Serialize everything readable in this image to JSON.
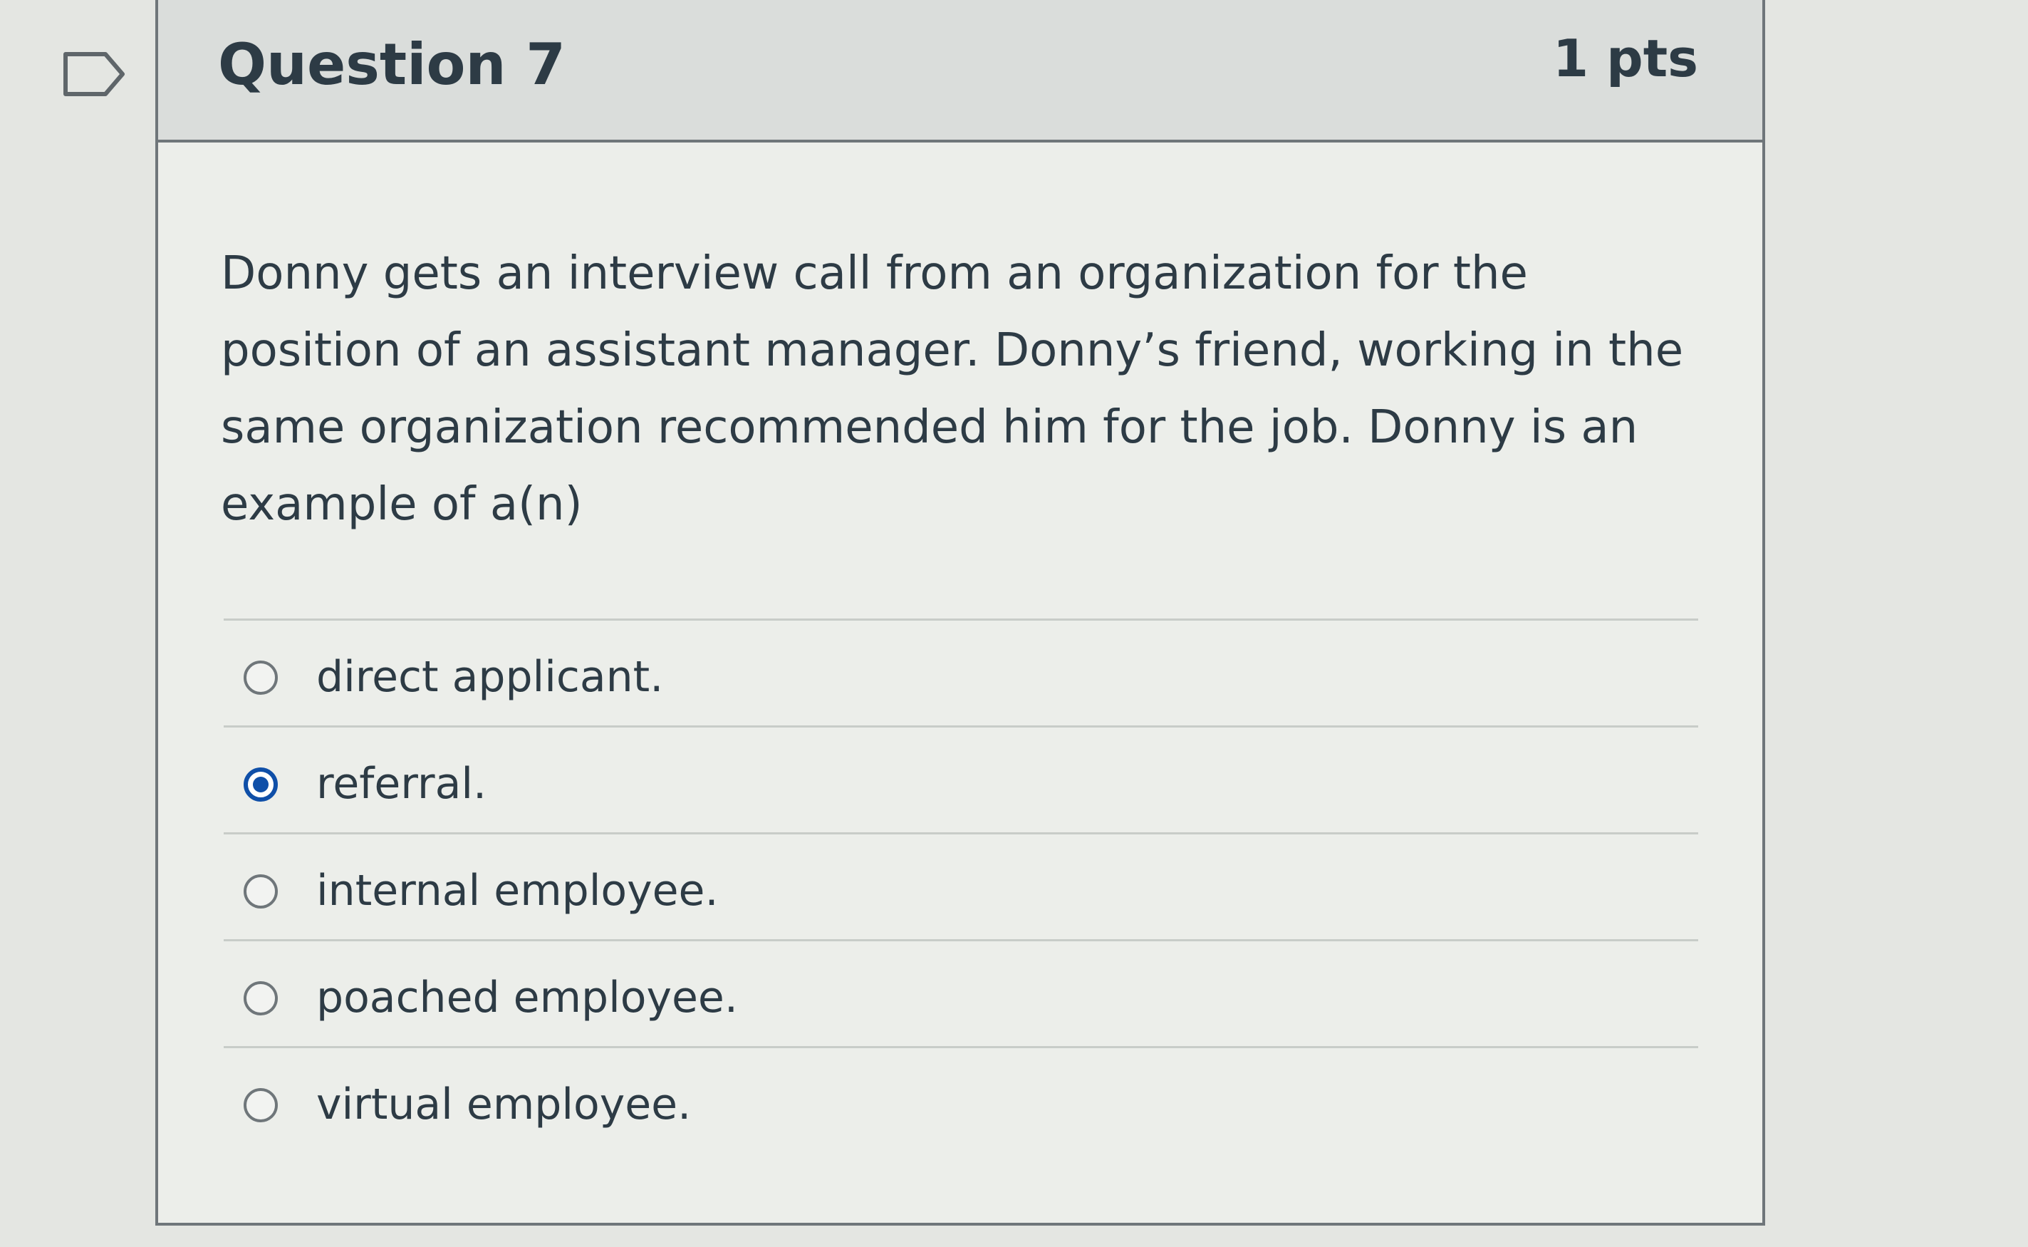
{
  "question": {
    "title": "Question 7",
    "points": "1 pts",
    "text": "Donny gets an interview call from an organization for the position of an assistant manager. Donny’s friend, working in the same organization recommended him for the job. Donny is an example of a(n)"
  },
  "flag": {
    "icon": "flag-question-icon"
  },
  "answers": [
    {
      "label": "direct applicant.",
      "selected": false
    },
    {
      "label": "referral.",
      "selected": true
    },
    {
      "label": "internal employee.",
      "selected": false
    },
    {
      "label": "poached employee.",
      "selected": false
    },
    {
      "label": "virtual employee.",
      "selected": false
    }
  ],
  "colors": {
    "accent": "#0f4fa8",
    "text": "#2d3b45",
    "border": "#6f767a"
  }
}
